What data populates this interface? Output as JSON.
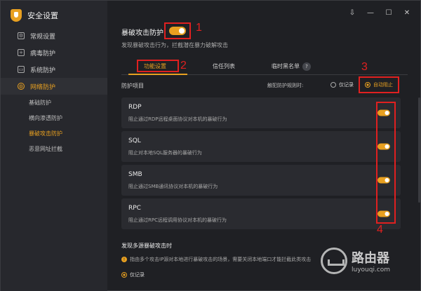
{
  "app": {
    "title": "安全设置"
  },
  "window_controls": [
    "⇩",
    "—",
    "☐",
    "✕"
  ],
  "sidebar": {
    "items": [
      {
        "label": "常规设置",
        "icon": "gear-icon"
      },
      {
        "label": "病毒防护",
        "icon": "plus-shield-icon"
      },
      {
        "label": "系统防护",
        "icon": "monitor-icon"
      },
      {
        "label": "网络防护",
        "icon": "globe-icon"
      }
    ],
    "subitems": [
      {
        "label": "基础防护"
      },
      {
        "label": "横向渗透防护"
      },
      {
        "label": "暴破攻击防护"
      },
      {
        "label": "恶意网址拦截"
      }
    ]
  },
  "main": {
    "title": "暴破攻击防护",
    "description": "发现暴破攻击行为，拦截潜在暴力破解攻击",
    "tabs": [
      {
        "label": "功能设置"
      },
      {
        "label": "信任列表"
      },
      {
        "label": "临时黑名单"
      }
    ],
    "badge": "?",
    "protection_title": "防护项目",
    "mode_label": "触犯防护规则时:",
    "mode_options": [
      {
        "label": "仅记录"
      },
      {
        "label": "自动阻止"
      }
    ],
    "cards": [
      {
        "title": "RDP",
        "desc": "阻止通过RDP远程桌面协议对本机的暴破行为"
      },
      {
        "title": "SQL",
        "desc": "阻止对本地SQL服务器的暴破行为"
      },
      {
        "title": "SMB",
        "desc": "阻止通过SMB通讯协议对本机的暴破行为"
      },
      {
        "title": "RPC",
        "desc": "阻止通过RPC远程调用协议对本机的暴破行为"
      }
    ],
    "multi_title": "发现多源暴破攻击时",
    "multi_desc": "指由多个攻击IP源对本地进行暴破攻击的场景，需要关闭本地端口才能拦截此类攻击",
    "only_log": "仅记录"
  },
  "annotations": [
    "1",
    "2",
    "3",
    "4"
  ],
  "watermark": {
    "name": "路由器",
    "url": "luyouqi.com"
  },
  "colors": {
    "accent": "#e8a020",
    "annotation": "#e02020"
  }
}
